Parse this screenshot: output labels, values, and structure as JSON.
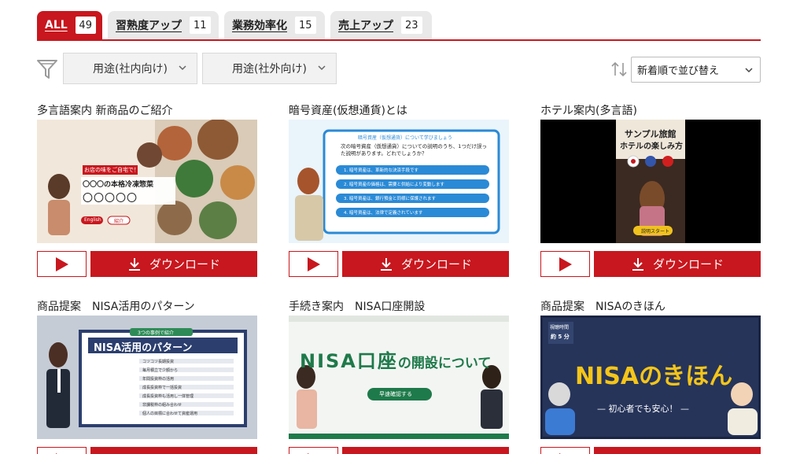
{
  "tabs": [
    {
      "label": "ALL",
      "count": "49"
    },
    {
      "label": "習熟度アップ",
      "count": "11"
    },
    {
      "label": "業務効率化",
      "count": "15"
    },
    {
      "label": "売上アップ",
      "count": "23"
    }
  ],
  "filters": {
    "internal": "用途(社内向け)",
    "external": "用途(社外向け)",
    "sort": "新着順で並び替え"
  },
  "buttons": {
    "download": "ダウンロード"
  },
  "cards": [
    {
      "title": "多言語案内 新商品のご紹介",
      "thumb": {
        "caption": "〇〇〇の本格冷凍惣菜",
        "sub": "〇〇〇〇〇",
        "badge": "お店の味をご自宅で！",
        "btn1": "English",
        "btn2": "紹介"
      }
    },
    {
      "title": "暗号資産(仮想通貨)とは",
      "thumb": {
        "header": "暗号資産（仮想通貨）について学びましょう",
        "question": "次の暗号資産（仮想通貨）についての説明のうち、1つだけ誤った説明があります。どれでしょうか？",
        "options": [
          "1. 暗号資産は、革新的な決済手段です",
          "2. 暗号資産の価格は、需要と供給により変動します",
          "3. 暗号資産は、銀行預金と同様に保護されます",
          "4. 暗号資産は、法律で定義されています"
        ]
      }
    },
    {
      "title": "ホテル案内(多言語)",
      "thumb": {
        "line1": "サンプル旅館",
        "line2": "ホテルの楽しみ方",
        "start": "説明スタート"
      }
    },
    {
      "title": "商品提案　NISA活用のパターン",
      "thumb": {
        "banner": "3つの事例で紹介",
        "heading": "NISA活用のパターン",
        "rows": [
          "コツコツ長期投資",
          "毎月積立で少額から",
          "年間投資枠の活用",
          "成長投資枠で一括投資",
          "成長投資枠も活用し一体管理",
          "非課税枠の組み合わせ",
          "個人の目標に合わせて資産運用"
        ]
      }
    },
    {
      "title": "手続き案内　NISA口座開設",
      "thumb": {
        "heading": "NISA口座",
        "suffix": "の開設について",
        "btn": "早速確認する"
      }
    },
    {
      "title": "商品提案　NISAのきほん",
      "thumb": {
        "badge1": "視聴時間",
        "badge2": "約 5 分",
        "heading": "NISAのきほん",
        "sub": "— 初心者でも安心！ —"
      }
    }
  ],
  "colors": {
    "brand_red": "#c8171e",
    "tab_grey": "#e9e9e9"
  },
  "icons": [
    "filter-icon",
    "chevron-down-icon",
    "sort-icon",
    "play-icon",
    "download-icon"
  ]
}
